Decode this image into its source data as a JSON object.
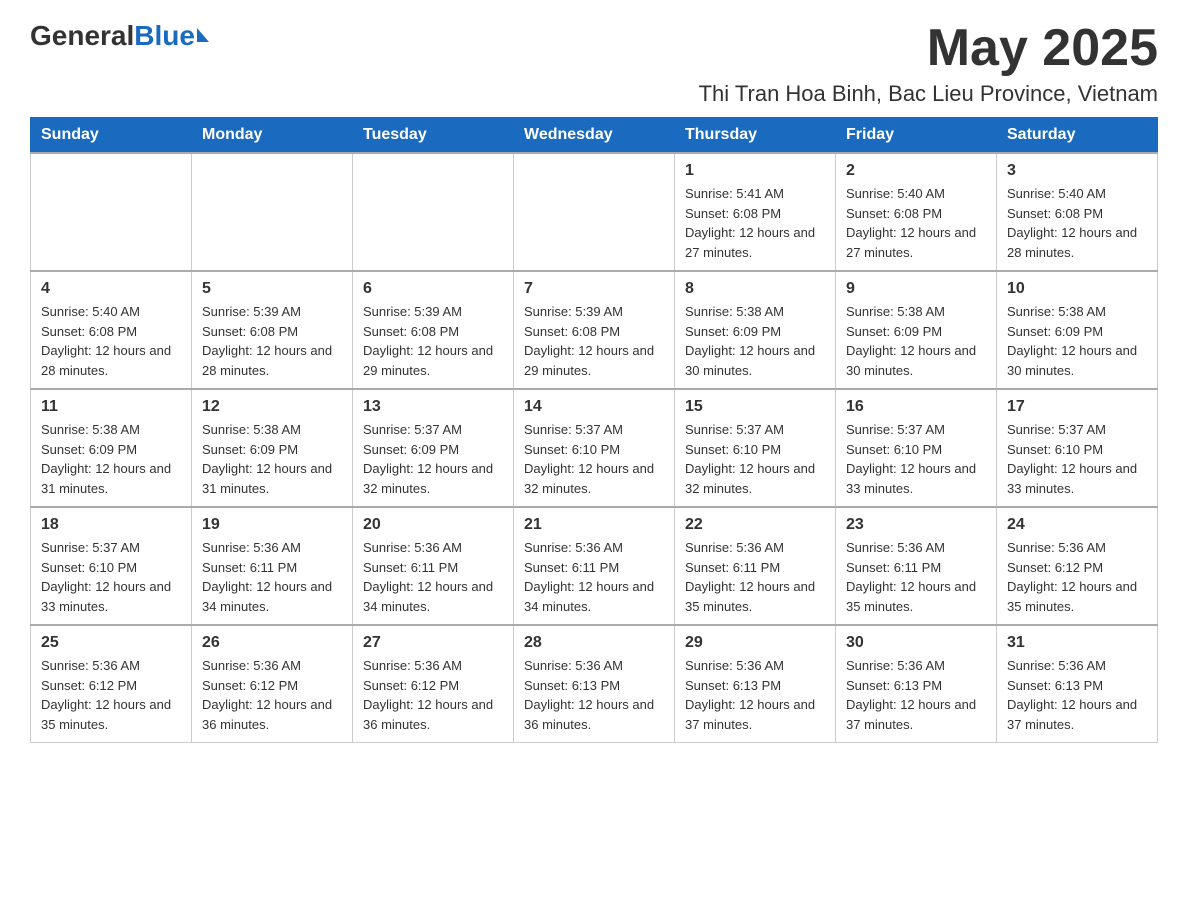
{
  "header": {
    "logo_general": "General",
    "logo_blue": "Blue",
    "month_title": "May 2025",
    "location": "Thi Tran Hoa Binh, Bac Lieu Province, Vietnam"
  },
  "days_of_week": [
    "Sunday",
    "Monday",
    "Tuesday",
    "Wednesday",
    "Thursday",
    "Friday",
    "Saturday"
  ],
  "weeks": [
    [
      {
        "day": "",
        "info": ""
      },
      {
        "day": "",
        "info": ""
      },
      {
        "day": "",
        "info": ""
      },
      {
        "day": "",
        "info": ""
      },
      {
        "day": "1",
        "info": "Sunrise: 5:41 AM\nSunset: 6:08 PM\nDaylight: 12 hours and 27 minutes."
      },
      {
        "day": "2",
        "info": "Sunrise: 5:40 AM\nSunset: 6:08 PM\nDaylight: 12 hours and 27 minutes."
      },
      {
        "day": "3",
        "info": "Sunrise: 5:40 AM\nSunset: 6:08 PM\nDaylight: 12 hours and 28 minutes."
      }
    ],
    [
      {
        "day": "4",
        "info": "Sunrise: 5:40 AM\nSunset: 6:08 PM\nDaylight: 12 hours and 28 minutes."
      },
      {
        "day": "5",
        "info": "Sunrise: 5:39 AM\nSunset: 6:08 PM\nDaylight: 12 hours and 28 minutes."
      },
      {
        "day": "6",
        "info": "Sunrise: 5:39 AM\nSunset: 6:08 PM\nDaylight: 12 hours and 29 minutes."
      },
      {
        "day": "7",
        "info": "Sunrise: 5:39 AM\nSunset: 6:08 PM\nDaylight: 12 hours and 29 minutes."
      },
      {
        "day": "8",
        "info": "Sunrise: 5:38 AM\nSunset: 6:09 PM\nDaylight: 12 hours and 30 minutes."
      },
      {
        "day": "9",
        "info": "Sunrise: 5:38 AM\nSunset: 6:09 PM\nDaylight: 12 hours and 30 minutes."
      },
      {
        "day": "10",
        "info": "Sunrise: 5:38 AM\nSunset: 6:09 PM\nDaylight: 12 hours and 30 minutes."
      }
    ],
    [
      {
        "day": "11",
        "info": "Sunrise: 5:38 AM\nSunset: 6:09 PM\nDaylight: 12 hours and 31 minutes."
      },
      {
        "day": "12",
        "info": "Sunrise: 5:38 AM\nSunset: 6:09 PM\nDaylight: 12 hours and 31 minutes."
      },
      {
        "day": "13",
        "info": "Sunrise: 5:37 AM\nSunset: 6:09 PM\nDaylight: 12 hours and 32 minutes."
      },
      {
        "day": "14",
        "info": "Sunrise: 5:37 AM\nSunset: 6:10 PM\nDaylight: 12 hours and 32 minutes."
      },
      {
        "day": "15",
        "info": "Sunrise: 5:37 AM\nSunset: 6:10 PM\nDaylight: 12 hours and 32 minutes."
      },
      {
        "day": "16",
        "info": "Sunrise: 5:37 AM\nSunset: 6:10 PM\nDaylight: 12 hours and 33 minutes."
      },
      {
        "day": "17",
        "info": "Sunrise: 5:37 AM\nSunset: 6:10 PM\nDaylight: 12 hours and 33 minutes."
      }
    ],
    [
      {
        "day": "18",
        "info": "Sunrise: 5:37 AM\nSunset: 6:10 PM\nDaylight: 12 hours and 33 minutes."
      },
      {
        "day": "19",
        "info": "Sunrise: 5:36 AM\nSunset: 6:11 PM\nDaylight: 12 hours and 34 minutes."
      },
      {
        "day": "20",
        "info": "Sunrise: 5:36 AM\nSunset: 6:11 PM\nDaylight: 12 hours and 34 minutes."
      },
      {
        "day": "21",
        "info": "Sunrise: 5:36 AM\nSunset: 6:11 PM\nDaylight: 12 hours and 34 minutes."
      },
      {
        "day": "22",
        "info": "Sunrise: 5:36 AM\nSunset: 6:11 PM\nDaylight: 12 hours and 35 minutes."
      },
      {
        "day": "23",
        "info": "Sunrise: 5:36 AM\nSunset: 6:11 PM\nDaylight: 12 hours and 35 minutes."
      },
      {
        "day": "24",
        "info": "Sunrise: 5:36 AM\nSunset: 6:12 PM\nDaylight: 12 hours and 35 minutes."
      }
    ],
    [
      {
        "day": "25",
        "info": "Sunrise: 5:36 AM\nSunset: 6:12 PM\nDaylight: 12 hours and 35 minutes."
      },
      {
        "day": "26",
        "info": "Sunrise: 5:36 AM\nSunset: 6:12 PM\nDaylight: 12 hours and 36 minutes."
      },
      {
        "day": "27",
        "info": "Sunrise: 5:36 AM\nSunset: 6:12 PM\nDaylight: 12 hours and 36 minutes."
      },
      {
        "day": "28",
        "info": "Sunrise: 5:36 AM\nSunset: 6:13 PM\nDaylight: 12 hours and 36 minutes."
      },
      {
        "day": "29",
        "info": "Sunrise: 5:36 AM\nSunset: 6:13 PM\nDaylight: 12 hours and 37 minutes."
      },
      {
        "day": "30",
        "info": "Sunrise: 5:36 AM\nSunset: 6:13 PM\nDaylight: 12 hours and 37 minutes."
      },
      {
        "day": "31",
        "info": "Sunrise: 5:36 AM\nSunset: 6:13 PM\nDaylight: 12 hours and 37 minutes."
      }
    ]
  ]
}
